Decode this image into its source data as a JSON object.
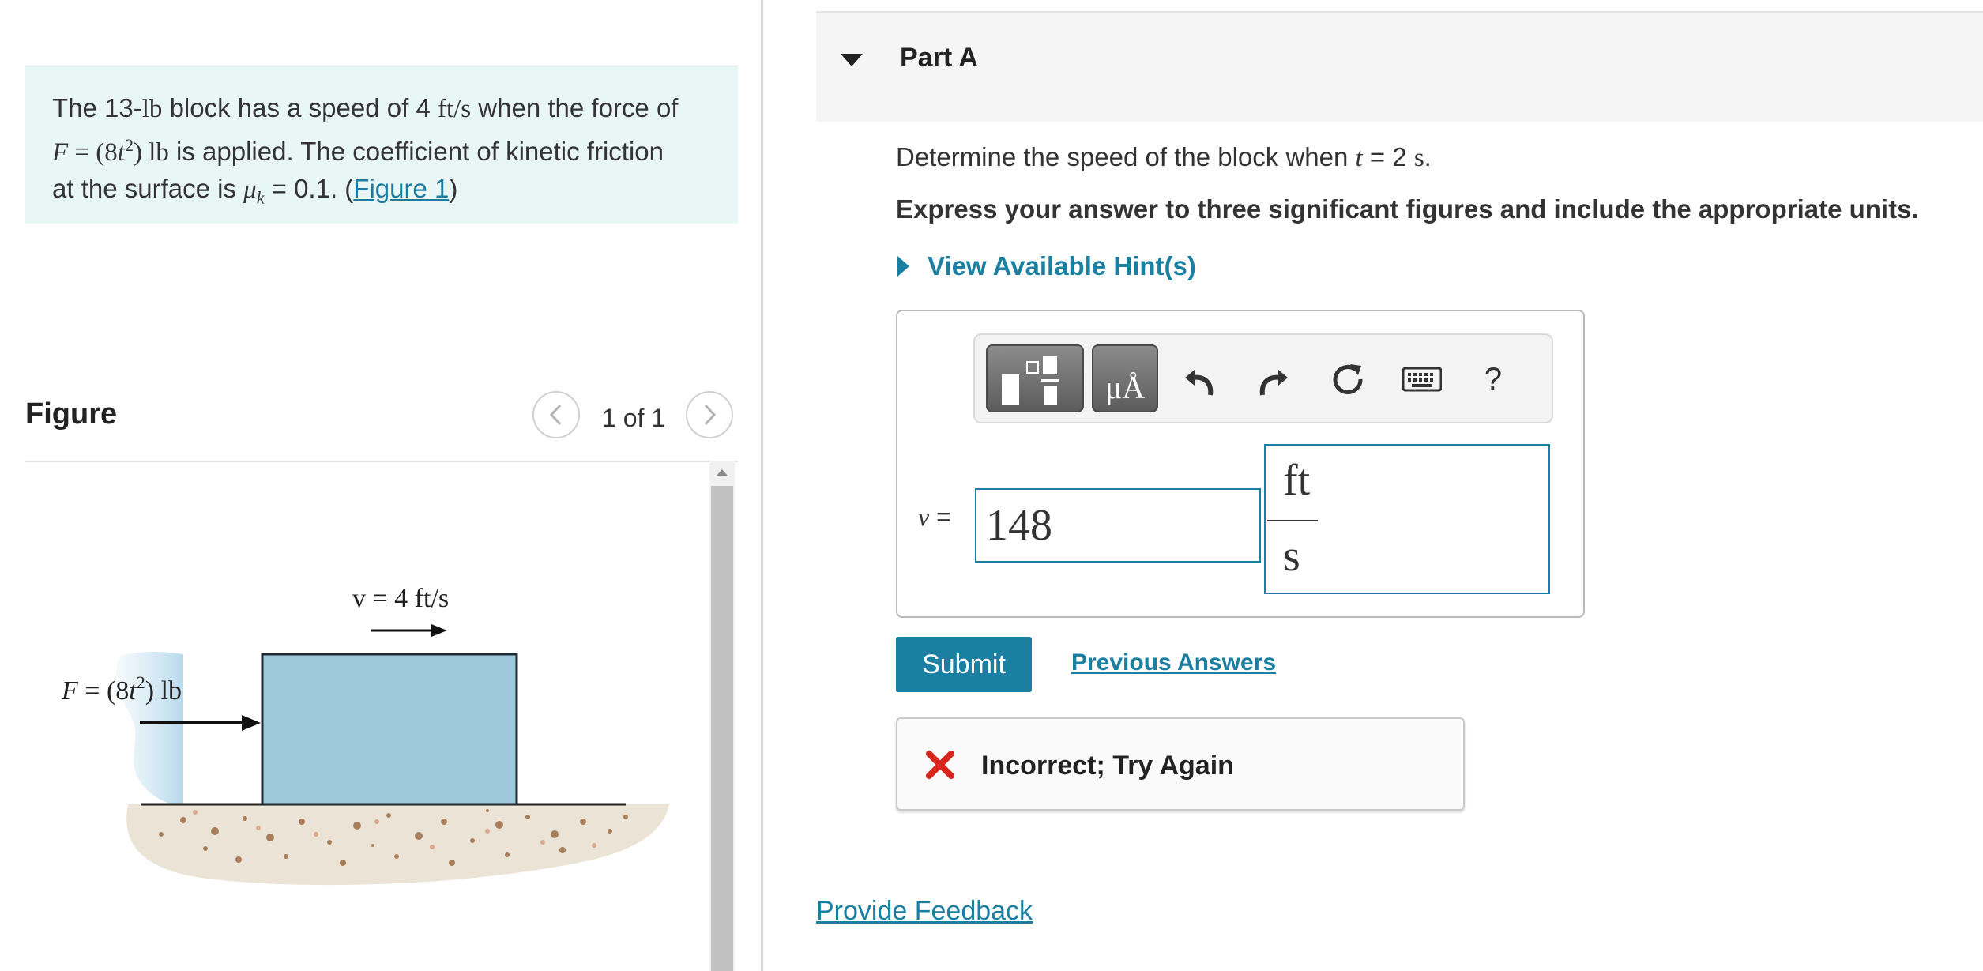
{
  "problem": {
    "p1": "The 13-",
    "p1_unit": "lb",
    "p2": " block has a speed of 4 ",
    "p2_unit": "ft/s",
    "p3": " when the force of",
    "p4_F": "F",
    "p4_eq": " = (8",
    "p4_t": "t",
    "p4_sup": "2",
    "p4_close": ") lb",
    "p5": " is applied. The coefficient of kinetic friction",
    "p6": "at the surface is ",
    "p6_mu": "μ",
    "p6_sub": "k",
    "p6_val": " = 0.1. (",
    "figure_link": "Figure 1",
    "p6_end": ")"
  },
  "figure_panel": {
    "title": "Figure",
    "counter": "1 of 1",
    "prev_icon": "chevron-left-icon",
    "next_icon": "chevron-right-icon",
    "velocity_label": "v = 4 ft/s",
    "force_label_F": "F",
    "force_label_eq": " = (8",
    "force_label_t": "t",
    "force_label_sup": "2",
    "force_label_close": ") lb"
  },
  "part": {
    "title": "Part A",
    "q_pre": "Determine the speed of the block when ",
    "q_t": "t",
    "q_post": " = 2 ",
    "q_unit": "s",
    "q_end": ".",
    "instruction": "Express your answer to three significant figures and include the appropriate units.",
    "hints_label": "View Available Hint(s)"
  },
  "toolbar": {
    "templates_icon": "templates-icon",
    "units_label": "μÅ",
    "undo_icon": "undo-icon",
    "redo_icon": "redo-icon",
    "reset_icon": "reset-icon",
    "keyboard_icon": "keyboard-icon",
    "help_label": "?"
  },
  "answer": {
    "var_v": "v",
    "var_eq": " =",
    "value": "148",
    "unit_numerator": "ft",
    "unit_denominator": "s"
  },
  "actions": {
    "submit_label": "Submit",
    "previous_answers_label": "Previous Answers"
  },
  "feedback": {
    "status_icon": "error-x-icon",
    "message": "Incorrect; Try Again",
    "color": "#d9261c"
  },
  "footer": {
    "provide_feedback_label": "Provide Feedback"
  },
  "colors": {
    "accent": "#1a7fa0",
    "problem_bg": "#e9f6f6",
    "block_fill": "#9fc7dc"
  }
}
